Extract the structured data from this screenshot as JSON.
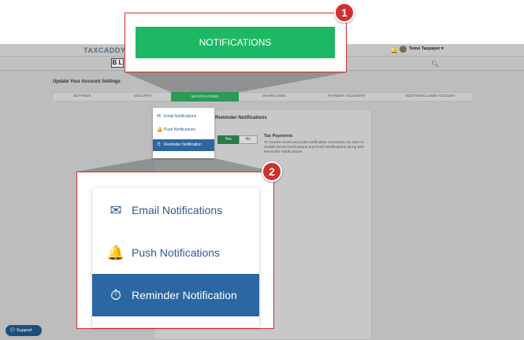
{
  "app": {
    "logo": "TAXCADDY",
    "user_name": "Temo Taxpayer ▾",
    "page_title": "Update Your Account Settings",
    "brand_mark": "B L"
  },
  "tabs": [
    {
      "label": "SETTINGS"
    },
    {
      "label": "SECURITY"
    },
    {
      "label": "NOTIFICATIONS"
    },
    {
      "label": "SHARE LINKS"
    },
    {
      "label": "PAYMENT ACCOUNTS"
    },
    {
      "label": "ADDITIONAL USER ACCOUNT"
    }
  ],
  "panel": {
    "heading": "Reminder Notifications",
    "tax_payments_title": "Tax Payments",
    "tax_payments_desc": "To receive email and push notification reminders, be sure to enable Email Notifications and Push Notifications along with Reminder Notifications",
    "yes": "Yes",
    "no": "No"
  },
  "menu": [
    {
      "label": "Email Notifications",
      "icon": "envelope-icon",
      "active": false
    },
    {
      "label": "Push Notifications",
      "icon": "bell-icon",
      "active": false
    },
    {
      "label": "Reminder Notification",
      "icon": "stopwatch-icon",
      "active": true
    }
  ],
  "callouts": {
    "one": {
      "number": "1",
      "label": "NOTIFICATIONS"
    },
    "two": {
      "number": "2"
    }
  },
  "support": "Support",
  "colors": {
    "green": "#1db864",
    "blue": "#2b67a3",
    "callout_red": "#d32f2f"
  }
}
